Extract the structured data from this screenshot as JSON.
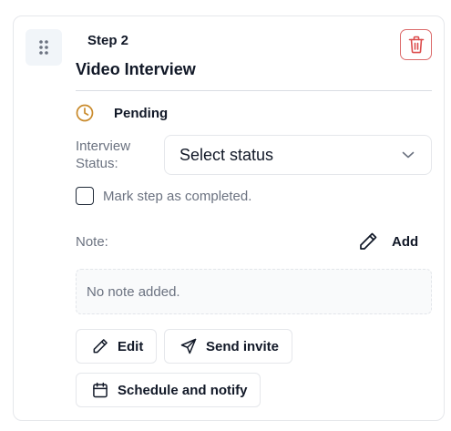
{
  "step": {
    "label": "Step 2",
    "title": "Video Interview",
    "status": "Pending",
    "status_color": "#c98a2b"
  },
  "interview_status": {
    "label": "Interview Status:",
    "select_value": "Select status"
  },
  "completed_checkbox": {
    "label": "Mark step as completed.",
    "checked": false
  },
  "note": {
    "label": "Note:",
    "add_label": "Add",
    "empty_text": "No note added."
  },
  "actions": {
    "edit_label": "Edit",
    "send_invite_label": "Send invite",
    "schedule_label": "Schedule and notify"
  },
  "colors": {
    "danger": "#dc6b6b",
    "pending": "#c98a2b",
    "muted_text": "#6b7280"
  }
}
